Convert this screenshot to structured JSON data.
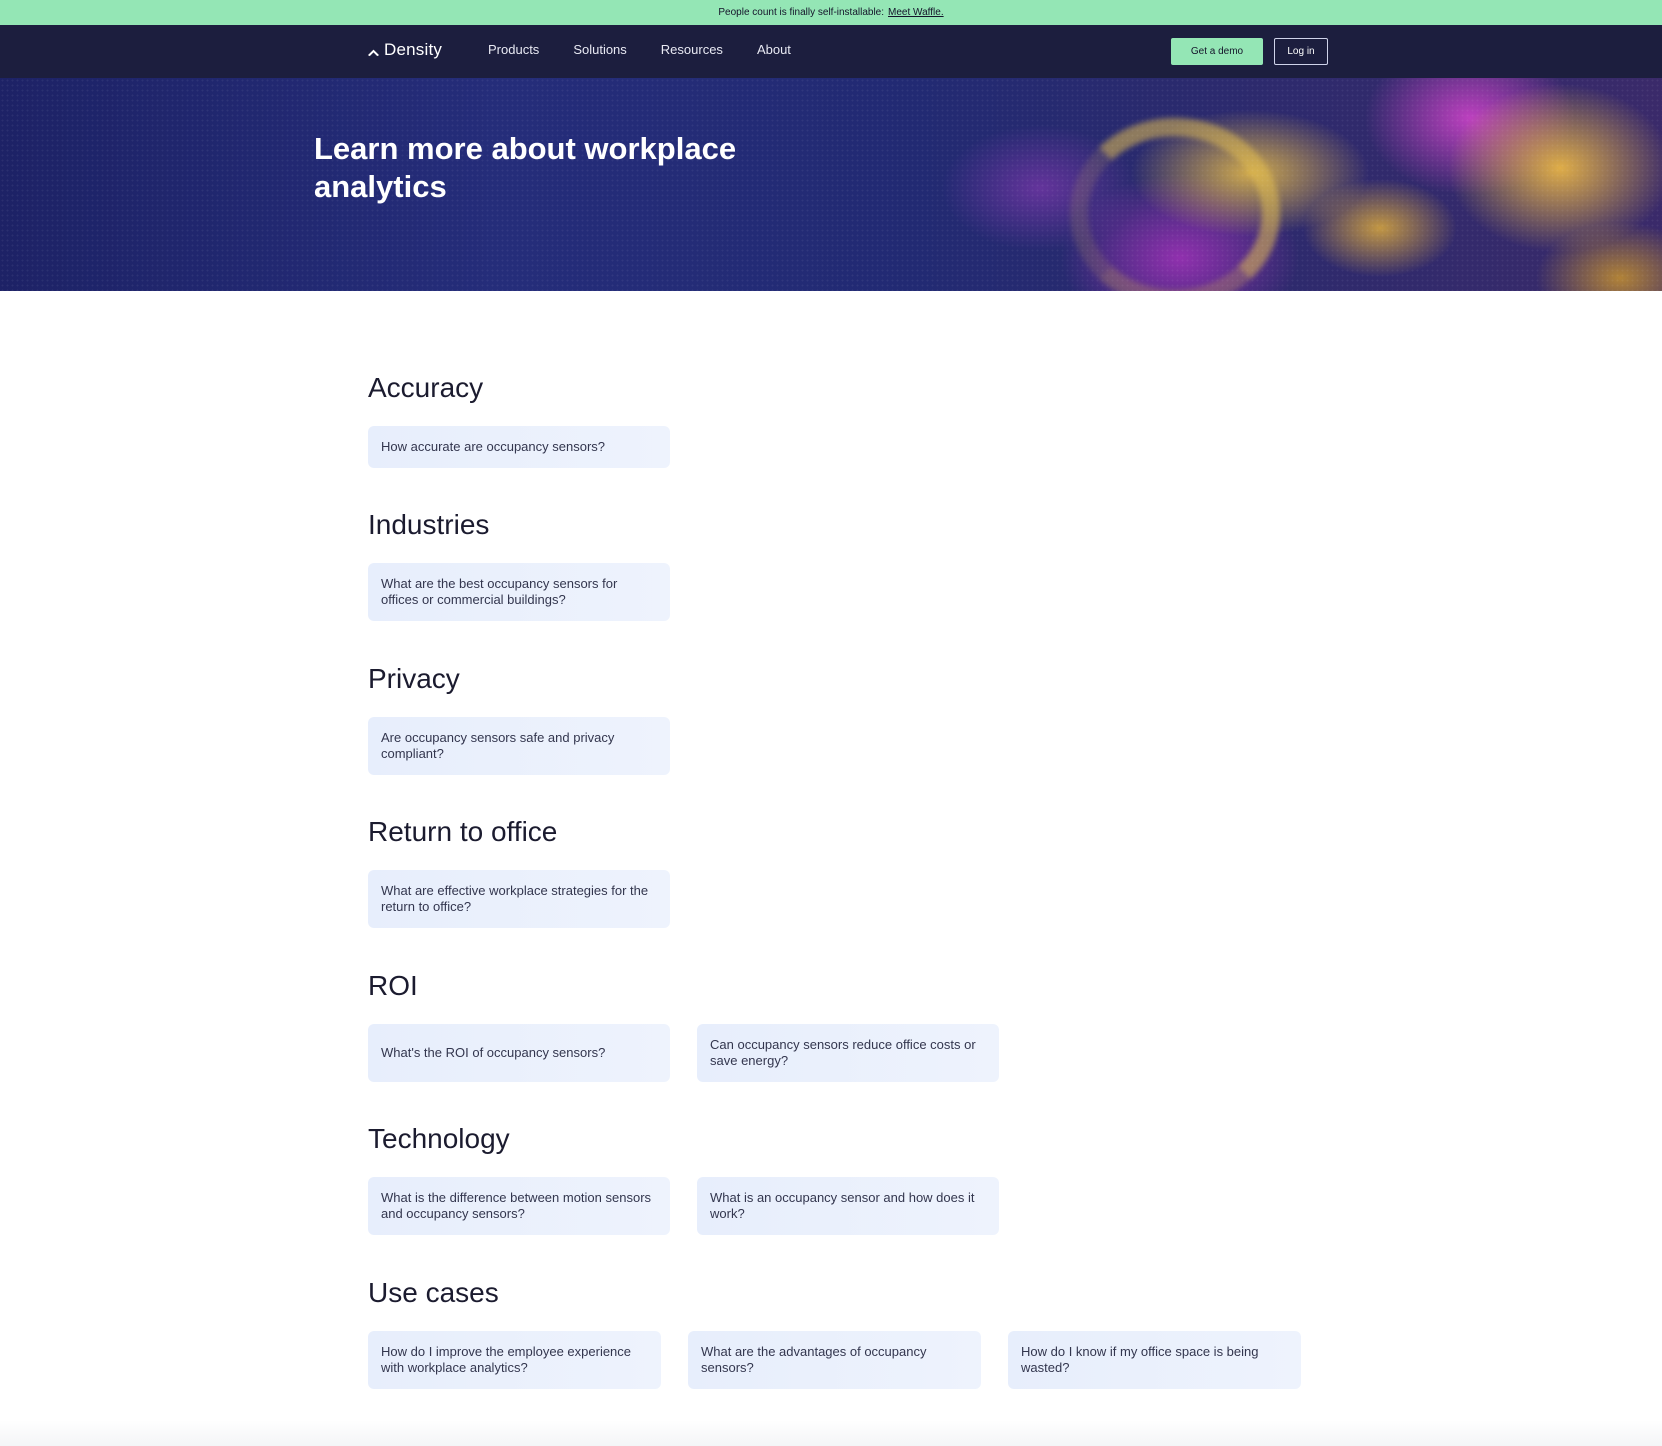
{
  "announcement": {
    "text": "People count is finally self-installable:",
    "link": "Meet Waffle."
  },
  "nav": {
    "logo": "Density",
    "links": [
      "Products",
      "Solutions",
      "Resources",
      "About"
    ],
    "demo_label": "Get a demo",
    "login_label": "Log in"
  },
  "hero": {
    "title": "Learn more about workplace analytics"
  },
  "sections": [
    {
      "title": "Accuracy",
      "items": [
        "How accurate are occupancy sensors?"
      ]
    },
    {
      "title": "Industries",
      "items": [
        "What are the best occupancy sensors for offices or commercial buildings?"
      ]
    },
    {
      "title": "Privacy",
      "items": [
        "Are occupancy sensors safe and privacy compliant?"
      ]
    },
    {
      "title": "Return to office",
      "items": [
        "What are effective workplace strategies for the return to office?"
      ]
    },
    {
      "title": "ROI",
      "items": [
        "What's the ROI of occupancy sensors?",
        "Can occupancy sensors reduce office costs or save energy?"
      ]
    },
    {
      "title": "Technology",
      "items": [
        "What is the difference between motion sensors and occupancy sensors?",
        "What is an occupancy sensor and how does it work?"
      ]
    },
    {
      "title": "Use cases",
      "items": [
        "How do I improve the employee experience with workplace analytics?",
        "What are the advantages of occupancy sensors?",
        "How do I know if my office space is being wasted?"
      ]
    }
  ],
  "colors": {
    "accent": "#94e6b5",
    "nav_bg": "#1c1e3e",
    "card_bg": "#e9f0fc"
  },
  "icons": {
    "logo": "density-logo-icon"
  }
}
